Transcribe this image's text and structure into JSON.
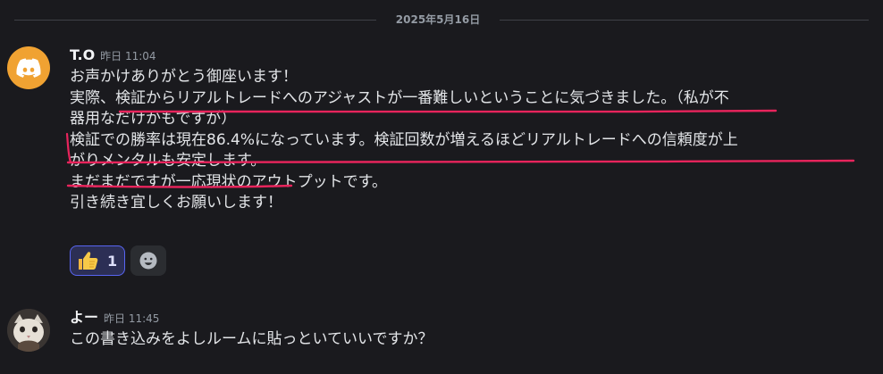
{
  "divider": {
    "date": "2025年5月16日"
  },
  "messages": [
    {
      "author": "T.O",
      "timestamp": "昨日 11:04",
      "avatar_icon": "discord-logo-icon",
      "lines": [
        "お声かけありがとう御座います！",
        "実際、検証からリアルトレードへのアジャストが一番難しいということに気づきました。（私が不",
        "器用なだけかもですが）",
        "検証での勝率は現在86.4%になっています。検証回数が増えるほどリアルトレードへの信頼度が上",
        "がりメンタルも安定します。",
        "まだまだですが一応現状のアウトプットです。",
        "引き続き宜しくお願いします！"
      ],
      "reactions": [
        {
          "emoji_icon": "thumbs-up-icon",
          "count": "1"
        },
        {
          "emoji_icon": "add-reaction-icon"
        }
      ]
    },
    {
      "author": "よー",
      "timestamp": "昨日 11:45",
      "avatar_icon": "cat-avatar",
      "lines": [
        "この書き込みをよしルームに貼っといていいですか？"
      ]
    }
  ],
  "colors": {
    "background": "#1a1a1e",
    "underline": "#e8245c",
    "discord_avatar": "#f0a232",
    "reaction_active_border": "#5865f2"
  }
}
